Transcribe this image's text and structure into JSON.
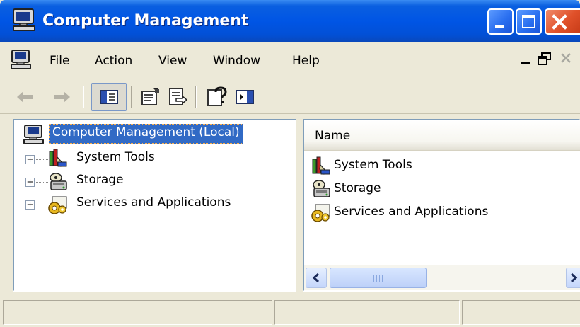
{
  "window": {
    "title": "Computer Management",
    "icon": "computer-icon"
  },
  "title_buttons": {
    "minimize": "minimize-icon",
    "maximize": "maximize-icon",
    "close": "close-icon"
  },
  "menu": {
    "items": [
      {
        "label": "File"
      },
      {
        "label": "Action"
      },
      {
        "label": "View"
      },
      {
        "label": "Window"
      },
      {
        "label": "Help"
      }
    ]
  },
  "toolbar": {
    "buttons": [
      {
        "icon": "back-arrow-icon"
      },
      {
        "icon": "forward-arrow-icon"
      },
      {
        "icon": "show-hide-console-tree-icon",
        "pressed": true
      },
      {
        "icon": "properties-icon"
      },
      {
        "icon": "export-list-icon"
      },
      {
        "icon": "help-icon"
      },
      {
        "icon": "show-hide-action-pane-icon"
      }
    ]
  },
  "tree": {
    "root": {
      "label": "Computer Management (Local)",
      "icon": "computer-icon",
      "selected": true
    },
    "items": [
      {
        "label": "System Tools",
        "icon": "system-tools-icon",
        "expander": "+"
      },
      {
        "label": "Storage",
        "icon": "storage-icon",
        "expander": "+"
      },
      {
        "label": "Services and Applications",
        "icon": "services-icon",
        "expander": "+"
      }
    ]
  },
  "list": {
    "columns": [
      {
        "label": "Name"
      }
    ],
    "items": [
      {
        "label": "System Tools",
        "icon": "system-tools-icon"
      },
      {
        "label": "Storage",
        "icon": "storage-icon"
      },
      {
        "label": "Services and Applications",
        "icon": "services-icon"
      }
    ]
  },
  "colors": {
    "titlebar": "#0055e5",
    "selection": "#316ac5",
    "window_face": "#ece9d8",
    "close_button": "#e0512a"
  }
}
